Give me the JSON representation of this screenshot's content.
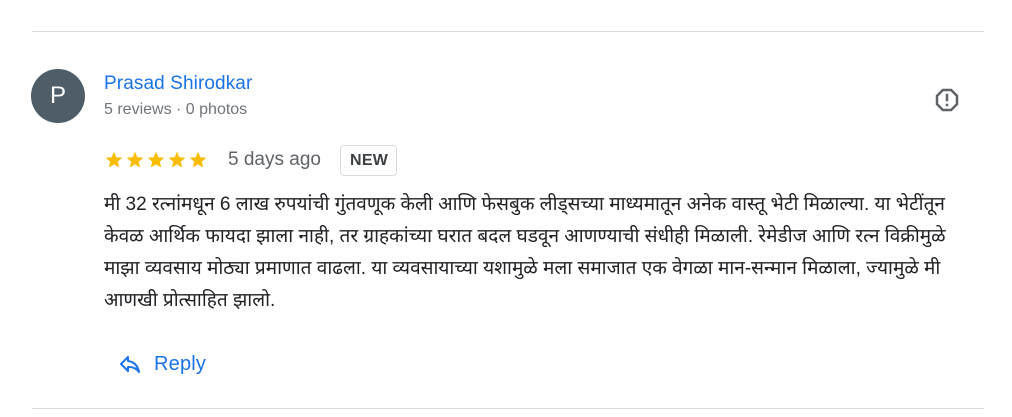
{
  "review": {
    "avatar_letter": "P",
    "author_name": "Prasad Shirodkar",
    "author_meta": "5 reviews · 0 photos",
    "rating": 5,
    "rating_max": 5,
    "date": "5 days ago",
    "badge": "NEW",
    "text": "मी 32 रत्नांमधून 6 लाख रुपयांची गुंतवणूक केली आणि फेसबुक लीड्सच्या माध्यमातून अनेक वास्तू भेटी मिळाल्या. या भेटींतून केवळ आर्थिक फायदा झाला नाही, तर ग्राहकांच्या घरात बदल घडवून आणण्याची संधीही मिळाली. रेमेडीज आणि रत्न विक्रीमुळे माझा व्यवसाय मोठ्या प्रमाणात वाढला. या व्यवसायाच्या यशामुळे मला समाजात एक वेगळा मान-सन्मान मिळाला, ज्यामुळे मी आणखी प्रोत्साहित झालो."
  },
  "actions": {
    "reply_label": "Reply",
    "reply_icon": "reply-icon",
    "flag_icon": "report-flag-icon"
  },
  "colors": {
    "link_blue": "#1a73e8",
    "star_yellow": "#fbbc04",
    "avatar_bg": "#4e5d68",
    "divider": "#dadce0"
  }
}
